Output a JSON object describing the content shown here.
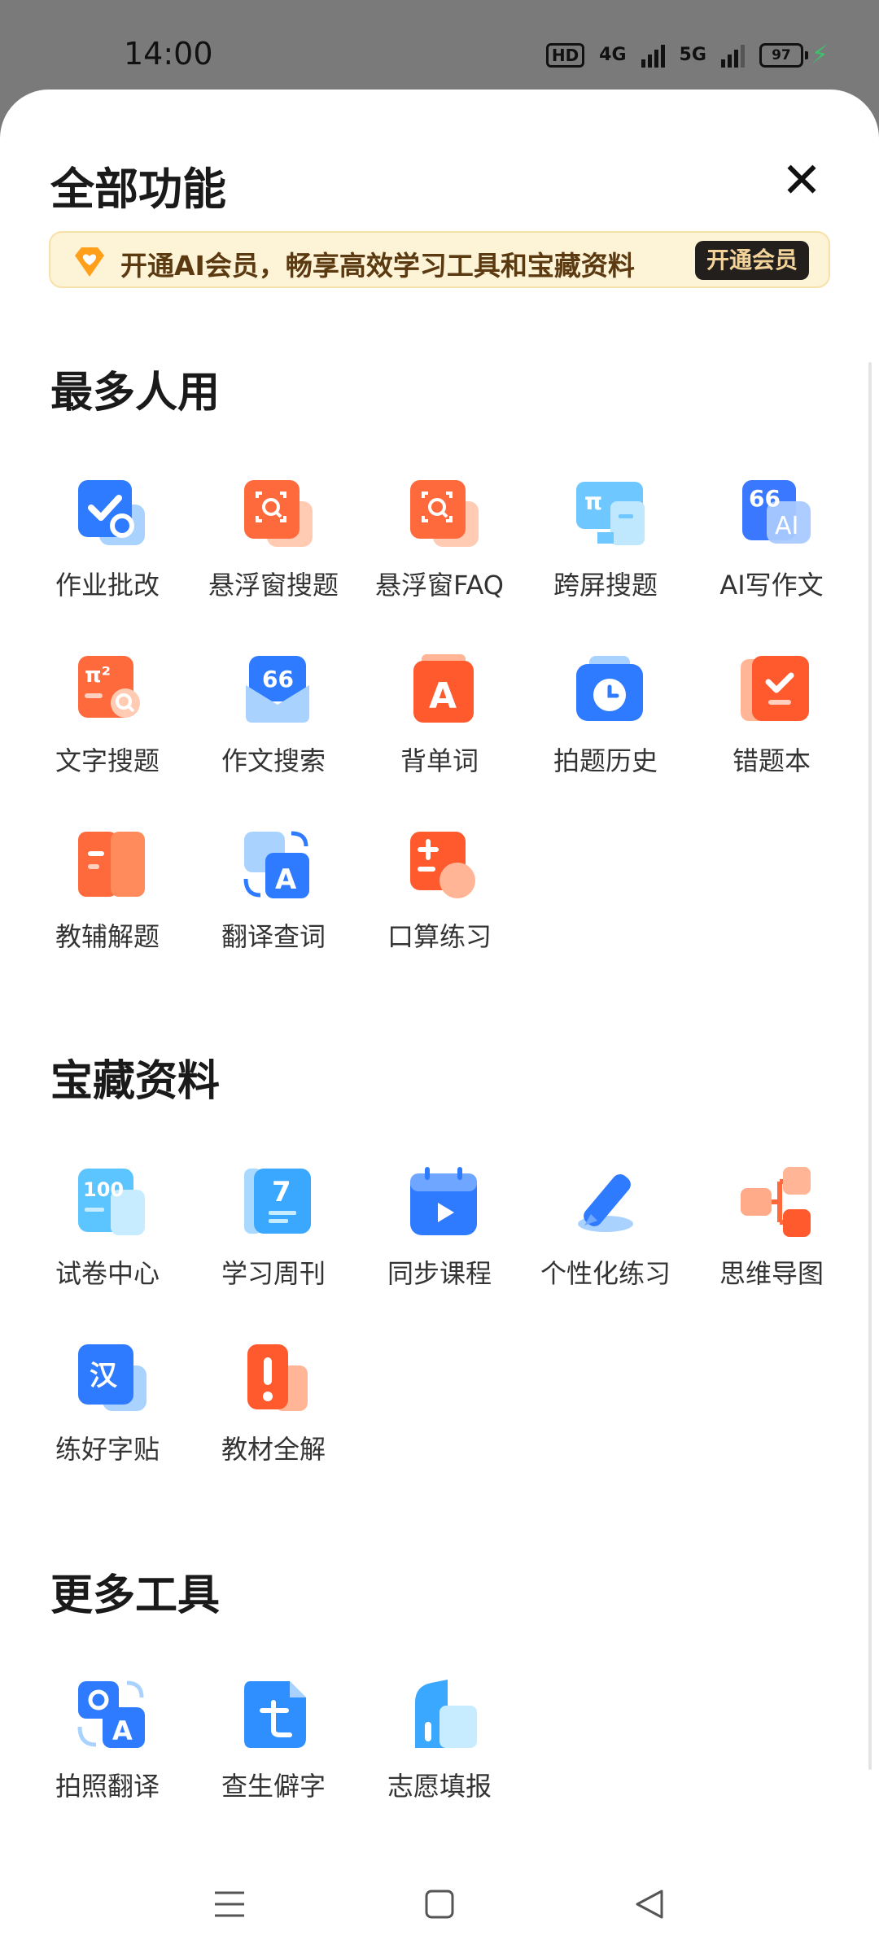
{
  "status": {
    "time": "14:00",
    "hd": "HD",
    "net1": "4G",
    "net2": "5G",
    "battery": "97"
  },
  "sheet": {
    "title": "全部功能",
    "close_symbol": "✕"
  },
  "vip": {
    "text": "开通AI会员，畅享高效学习工具和宝藏资料",
    "button": "开通会员",
    "icon": "diamond-heart-icon"
  },
  "sections": [
    {
      "title": "最多人用",
      "items": [
        {
          "label": "作业批改",
          "icon": "homework-check-icon"
        },
        {
          "label": "悬浮窗搜题",
          "icon": "floating-scan-icon"
        },
        {
          "label": "悬浮窗FAQ",
          "icon": "floating-faq-icon"
        },
        {
          "label": "跨屏搜题",
          "icon": "cross-screen-icon"
        },
        {
          "label": "AI写作文",
          "icon": "ai-writing-icon"
        },
        {
          "label": "文字搜题",
          "icon": "text-search-icon"
        },
        {
          "label": "作文搜索",
          "icon": "essay-search-icon"
        },
        {
          "label": "背单词",
          "icon": "vocabulary-icon"
        },
        {
          "label": "拍题历史",
          "icon": "photo-history-icon"
        },
        {
          "label": "错题本",
          "icon": "mistake-book-icon"
        },
        {
          "label": "教辅解题",
          "icon": "tutorial-book-icon"
        },
        {
          "label": "翻译查词",
          "icon": "translate-icon"
        },
        {
          "label": "口算练习",
          "icon": "mental-math-icon"
        }
      ]
    },
    {
      "title": "宝藏资料",
      "items": [
        {
          "label": "试卷中心",
          "icon": "exam-paper-icon"
        },
        {
          "label": "学习周刊",
          "icon": "weekly-icon"
        },
        {
          "label": "同步课程",
          "icon": "course-video-icon"
        },
        {
          "label": "个性化练习",
          "icon": "pen-practice-icon"
        },
        {
          "label": "思维导图",
          "icon": "mind-map-icon"
        },
        {
          "label": "练好字贴",
          "icon": "calligraphy-icon"
        },
        {
          "label": "教材全解",
          "icon": "textbook-icon"
        }
      ]
    },
    {
      "title": "更多工具",
      "items": [
        {
          "label": "拍照翻译",
          "icon": "photo-translate-icon"
        },
        {
          "label": "查生僻字",
          "icon": "rare-char-icon"
        },
        {
          "label": "志愿填报",
          "icon": "college-apply-icon"
        }
      ]
    }
  ],
  "glyphs": {
    "pi": "π²",
    "quote": "66",
    "ai_quote": "66",
    "ai": "AI",
    "letter_a": "A",
    "n100": "100",
    "n7": "7",
    "han": "汉",
    "pi_small": "π"
  }
}
